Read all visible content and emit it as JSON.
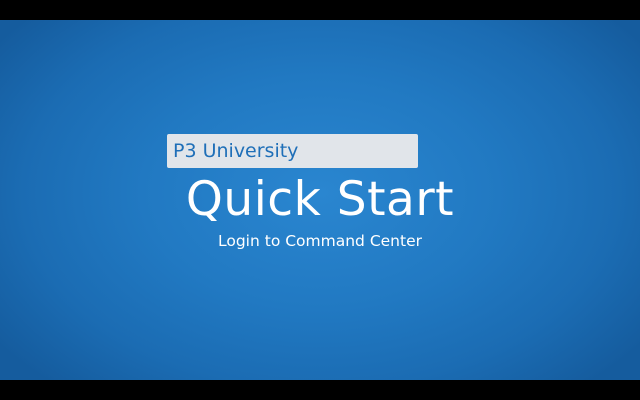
{
  "slide": {
    "brand": "P3 University",
    "title": "Quick Start",
    "subtitle": "Login to Command Center"
  },
  "colors": {
    "letterbox": "#000000",
    "background_center": "#2a86d0",
    "background_edge": "#155c9e",
    "badge_background": "#e1e5ea",
    "badge_text": "#1f6fb8",
    "title_text": "#ffffff"
  }
}
